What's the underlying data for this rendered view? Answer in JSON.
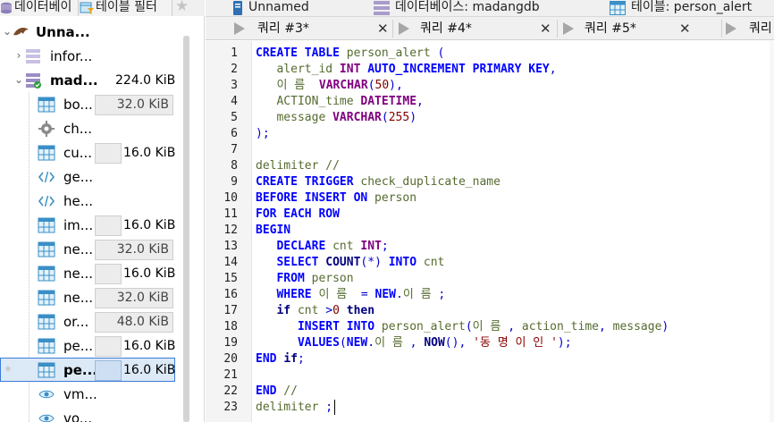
{
  "left_tabs": [
    {
      "label": "데이터베이",
      "icon": "database-icon"
    },
    {
      "label": "테이블 필터",
      "icon": "table-filter-icon"
    },
    {
      "label": "",
      "icon": "star-icon"
    }
  ],
  "tree": {
    "root": {
      "label": "Unna..."
    },
    "info_schema": {
      "label": "infor..."
    },
    "db": {
      "label": "mad...",
      "size": "224.0 KiB"
    },
    "items": [
      {
        "label": "bo...",
        "icon": "table-icon",
        "size": "32.0 KiB"
      },
      {
        "label": "ch...",
        "icon": "gear-icon",
        "size": ""
      },
      {
        "label": "cu...",
        "icon": "table-icon",
        "size": "16.0 KiB"
      },
      {
        "label": "ge...",
        "icon": "code-icon",
        "size": ""
      },
      {
        "label": "he...",
        "icon": "code-icon",
        "size": ""
      },
      {
        "label": "im...",
        "icon": "table-icon",
        "size": "16.0 KiB"
      },
      {
        "label": "ne...",
        "icon": "table-icon",
        "size": "32.0 KiB"
      },
      {
        "label": "ne...",
        "icon": "table-icon",
        "size": "16.0 KiB"
      },
      {
        "label": "ne...",
        "icon": "table-icon",
        "size": "32.0 KiB"
      },
      {
        "label": "or...",
        "icon": "table-icon",
        "size": "48.0 KiB"
      },
      {
        "label": "pe...",
        "icon": "table-icon",
        "size": "16.0 KiB"
      },
      {
        "label": "pe...",
        "icon": "table-icon",
        "size": "16.0 KiB"
      },
      {
        "label": "vm...",
        "icon": "view-icon",
        "size": ""
      },
      {
        "label": "vo...",
        "icon": "view-icon",
        "size": ""
      }
    ]
  },
  "doc_tabs": [
    {
      "label": "Unnamed",
      "icon": "server-icon"
    },
    {
      "label": "데이터베이스: madangdb",
      "icon": "database-icon"
    },
    {
      "label": "테이블: person_alert",
      "icon": "table-icon"
    }
  ],
  "query_tabs": [
    {
      "label": "쿼리 #3*",
      "close": "✕"
    },
    {
      "label": "쿼리 #4*",
      "close": "✕"
    },
    {
      "label": "쿼리 #5*",
      "close": "✕"
    },
    {
      "label": "쿼리",
      "close": ""
    }
  ],
  "editor": {
    "line_numbers": [
      "1",
      "2",
      "3",
      "4",
      "5",
      "6",
      "7",
      "8",
      "9",
      "10",
      "11",
      "12",
      "13",
      "14",
      "15",
      "16",
      "17",
      "18",
      "19",
      "20",
      "21",
      "22",
      "23"
    ],
    "code": {
      "l1": [
        {
          "t": "CREATE TABLE",
          "c": "kw"
        },
        {
          "t": " person_alert ",
          "c": "id"
        },
        {
          "t": "(",
          "c": "op"
        }
      ],
      "l2": [
        {
          "t": "   alert_id ",
          "c": "id"
        },
        {
          "t": "INT",
          "c": "typ"
        },
        {
          "t": " AUTO_INCREMENT PRIMARY KEY",
          "c": "kw"
        },
        {
          "t": ",",
          "c": "op"
        }
      ],
      "l3": [
        {
          "t": "   이 름  ",
          "c": "id"
        },
        {
          "t": "VARCHAR",
          "c": "typ"
        },
        {
          "t": "(",
          "c": "op"
        },
        {
          "t": "50",
          "c": "num"
        },
        {
          "t": "),",
          "c": "op"
        }
      ],
      "l4": [
        {
          "t": "   ACTION_time ",
          "c": "id"
        },
        {
          "t": "DATETIME",
          "c": "typ"
        },
        {
          "t": ",",
          "c": "op"
        }
      ],
      "l5": [
        {
          "t": "   message ",
          "c": "id"
        },
        {
          "t": "VARCHAR",
          "c": "typ"
        },
        {
          "t": "(",
          "c": "op"
        },
        {
          "t": "255",
          "c": "num"
        },
        {
          "t": ")",
          "c": "op"
        }
      ],
      "l6": [
        {
          "t": ");",
          "c": "op"
        }
      ],
      "l7": [],
      "l8": [
        {
          "t": "delimiter //",
          "c": "com"
        }
      ],
      "l9": [
        {
          "t": "CREATE TRIGGER",
          "c": "kw"
        },
        {
          "t": " check_duplicate_name",
          "c": "id"
        }
      ],
      "l10": [
        {
          "t": "BEFORE INSERT ON",
          "c": "kw"
        },
        {
          "t": " person",
          "c": "id"
        }
      ],
      "l11": [
        {
          "t": "FOR EACH ROW",
          "c": "kw"
        }
      ],
      "l12": [
        {
          "t": "BEGIN",
          "c": "kw"
        }
      ],
      "l13": [
        {
          "t": "   ",
          "c": ""
        },
        {
          "t": "DECLARE",
          "c": "kw"
        },
        {
          "t": " cnt ",
          "c": "id"
        },
        {
          "t": "INT",
          "c": "typ"
        },
        {
          "t": ";",
          "c": "op"
        }
      ],
      "l14": [
        {
          "t": "   ",
          "c": ""
        },
        {
          "t": "SELECT",
          "c": "kw"
        },
        {
          "t": " ",
          "c": ""
        },
        {
          "t": "COUNT",
          "c": "kwb"
        },
        {
          "t": "(*)",
          "c": "op"
        },
        {
          "t": " ",
          "c": ""
        },
        {
          "t": "INTO",
          "c": "kw"
        },
        {
          "t": " cnt",
          "c": "id"
        }
      ],
      "l15": [
        {
          "t": "   ",
          "c": ""
        },
        {
          "t": "FROM",
          "c": "kw"
        },
        {
          "t": " person",
          "c": "id"
        }
      ],
      "l16": [
        {
          "t": "   ",
          "c": ""
        },
        {
          "t": "WHERE",
          "c": "kw"
        },
        {
          "t": " 이 름  ",
          "c": "id"
        },
        {
          "t": "=",
          "c": "op"
        },
        {
          "t": " ",
          "c": ""
        },
        {
          "t": "NEW",
          "c": "kw"
        },
        {
          "t": ".",
          "c": "op"
        },
        {
          "t": "이 름 ",
          "c": "id"
        },
        {
          "t": ";",
          "c": "op"
        }
      ],
      "l17": [
        {
          "t": "   ",
          "c": ""
        },
        {
          "t": "if",
          "c": "kwb"
        },
        {
          "t": " cnt ",
          "c": "id"
        },
        {
          "t": ">",
          "c": "op"
        },
        {
          "t": "0",
          "c": "num"
        },
        {
          "t": " ",
          "c": ""
        },
        {
          "t": "then",
          "c": "kwb"
        }
      ],
      "l18": [
        {
          "t": "      ",
          "c": ""
        },
        {
          "t": "INSERT INTO",
          "c": "kw"
        },
        {
          "t": " person_alert",
          "c": "id"
        },
        {
          "t": "(",
          "c": "op"
        },
        {
          "t": "이 름 ",
          "c": "id"
        },
        {
          "t": ", ",
          "c": "op"
        },
        {
          "t": "action_time",
          "c": "id"
        },
        {
          "t": ", ",
          "c": "op"
        },
        {
          "t": "message",
          "c": "id"
        },
        {
          "t": ")",
          "c": "op"
        }
      ],
      "l19": [
        {
          "t": "      ",
          "c": ""
        },
        {
          "t": "VALUES",
          "c": "kw"
        },
        {
          "t": "(",
          "c": "op"
        },
        {
          "t": "NEW",
          "c": "kw"
        },
        {
          "t": ".",
          "c": "op"
        },
        {
          "t": "이 름 ",
          "c": "id"
        },
        {
          "t": ", ",
          "c": "op"
        },
        {
          "t": "NOW",
          "c": "kwb"
        },
        {
          "t": "(), ",
          "c": "op"
        },
        {
          "t": "'동 명 이 인 '",
          "c": "str"
        },
        {
          "t": ");",
          "c": "op"
        }
      ],
      "l20": [
        {
          "t": "END",
          "c": "kw"
        },
        {
          "t": " ",
          "c": ""
        },
        {
          "t": "if",
          "c": "kwb"
        },
        {
          "t": ";",
          "c": "op"
        }
      ],
      "l21": [],
      "l22": [
        {
          "t": "END",
          "c": "kw"
        },
        {
          "t": " //",
          "c": "com"
        }
      ],
      "l23": [
        {
          "t": "delimiter ",
          "c": "com"
        },
        {
          "t": ";",
          "c": "op"
        }
      ]
    }
  },
  "colors": {
    "keyword": "#0000ff",
    "type": "#800080",
    "identifier": "#556b2f",
    "number": "#800000",
    "string": "#8b0000",
    "selection_border": "#3c7bd6"
  }
}
